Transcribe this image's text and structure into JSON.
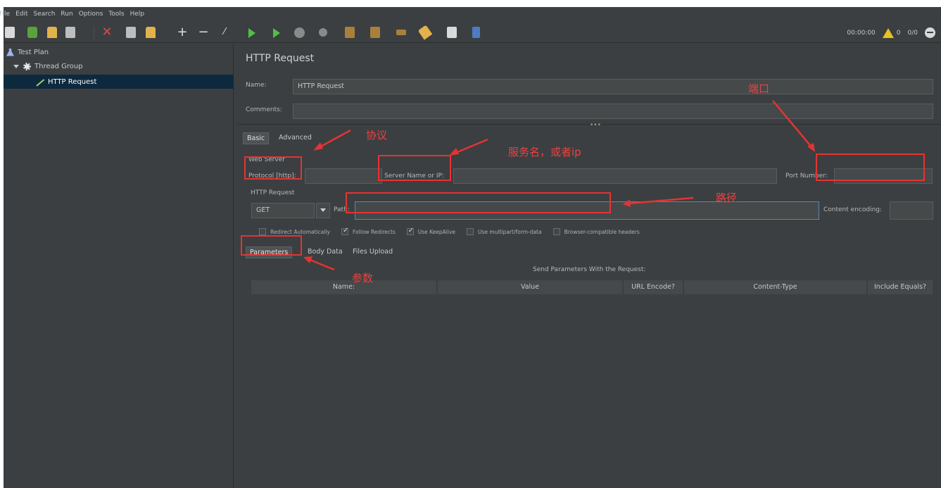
{
  "menu": [
    "File",
    "Edit",
    "Search",
    "Run",
    "Options",
    "Tools",
    "Help"
  ],
  "status": {
    "timer": "00:00:00",
    "warnings": "0",
    "threads": "0/0"
  },
  "tree": {
    "test_plan": "Test Plan",
    "thread_group": "Thread Group",
    "http_request": "HTTP Request"
  },
  "editor": {
    "title": "HTTP Request",
    "name_label": "Name:",
    "name_value": "HTTP Request",
    "comments_label": "Comments:",
    "comments_value": "",
    "tabs": [
      "Basic",
      "Advanced"
    ],
    "web_server_label": "Web Server",
    "protocol_label": "Protocol [http]:",
    "protocol_value": "",
    "server_label": "Server Name or IP:",
    "server_value": "",
    "port_label": "Port Number:",
    "port_value": "",
    "http_request_label": "HTTP Request",
    "method": "GET",
    "path_label": "Path:",
    "path_value": "",
    "encoding_label": "Content encoding:",
    "encoding_value": "",
    "options": [
      {
        "label": "Redirect Automatically",
        "checked": false
      },
      {
        "label": "Follow Redirects",
        "checked": true
      },
      {
        "label": "Use KeepAlive",
        "checked": true
      },
      {
        "label": "Use multipart/form-data",
        "checked": false
      },
      {
        "label": "Browser-compatible headers",
        "checked": false
      }
    ],
    "subtabs": [
      "Parameters",
      "Body Data",
      "Files Upload"
    ],
    "params_caption": "Send Parameters With the Request:",
    "columns": [
      "Name:",
      "Value",
      "URL Encode?",
      "Content-Type",
      "Include Equals?"
    ]
  },
  "annotations": {
    "protocol": "协议",
    "server": "服务名，或者ip",
    "port": "端口",
    "path": "路径",
    "params": "参数"
  },
  "colors": {
    "background": "#3b3f41",
    "selection": "#0d293e",
    "annotation": "#e53333"
  }
}
